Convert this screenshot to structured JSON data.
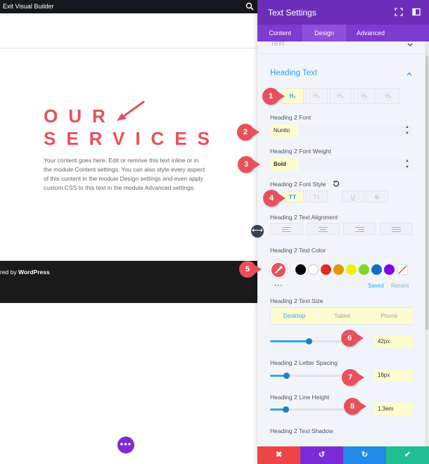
{
  "canvas": {
    "topbar": {
      "exit_label": "Exit Visual Builder"
    },
    "hero": {
      "heading_line1": "OUR",
      "heading_line2": "SERVICES",
      "heading_color": "#e8505b",
      "body": "Your content goes here. Edit or remove this text inline or in the module Content settings. You can also style every aspect of this content in the module Design settings and even apply custom CSS to this text in the module Advanced settings."
    },
    "footer": {
      "prefix": "red by ",
      "brand": "WordPress"
    },
    "dots_button": "•••"
  },
  "panel": {
    "title": "Text Settings",
    "tabs": [
      {
        "label": "Content",
        "active": false
      },
      {
        "label": "Design",
        "active": true
      },
      {
        "label": "Advanced",
        "active": false
      }
    ],
    "collapsed_section": "Text",
    "section_title": "Heading Text",
    "heading_levels": [
      {
        "label": "H₂",
        "active": true
      },
      {
        "label": "H₃",
        "active": false
      },
      {
        "label": "H₄",
        "active": false
      },
      {
        "label": "H₅",
        "active": false
      },
      {
        "label": "H₆",
        "active": false
      }
    ],
    "font": {
      "label": "Heading 2 Font",
      "value": "Nunito"
    },
    "weight": {
      "label": "Heading 2 Font Weight",
      "value": "Bold"
    },
    "style": {
      "label": "Heading 2 Font Style",
      "buttons": [
        {
          "label": "TT",
          "active": true
        },
        {
          "label": "Tт",
          "active": false
        },
        {
          "label": "U",
          "active": false
        },
        {
          "label": "S",
          "active": false
        }
      ]
    },
    "alignment": {
      "label": "Heading 2 Text Alignment"
    },
    "color": {
      "label": "Heading 2 Text Color",
      "current": "#e8505b",
      "swatches": [
        "#000000",
        "#ffffff",
        "#e02b20",
        "#e09900",
        "#edf000",
        "#7cda24",
        "#0c71c3",
        "#8300e9"
      ],
      "saved_label": "Saved",
      "recent_label": "Recent"
    },
    "size": {
      "label": "Heading 2 Text Size",
      "devices": [
        {
          "label": "Desktop",
          "active": true
        },
        {
          "label": "Tablet",
          "active": false
        },
        {
          "label": "Phone",
          "active": false
        }
      ],
      "value": "42px",
      "slider_fraction": 0.42
    },
    "letter_spacing": {
      "label": "Heading 2 Letter Spacing",
      "value": "16px",
      "slider_fraction": 0.18
    },
    "line_height": {
      "label": "Heading 2 Line Height",
      "value": "1.3em",
      "slider_fraction": 0.17
    },
    "shadow": {
      "label": "Heading 2 Text Shadow"
    },
    "footer_buttons": [
      {
        "name": "cancel",
        "symbol": "✖",
        "color": "#ef4444"
      },
      {
        "name": "undo",
        "symbol": "↺",
        "color": "#7b2bd4"
      },
      {
        "name": "redo",
        "symbol": "↻",
        "color": "#1f8ae8"
      },
      {
        "name": "save",
        "symbol": "✔",
        "color": "#1fbf8f"
      }
    ]
  },
  "markers": [
    "1",
    "2",
    "3",
    "4",
    "5",
    "6",
    "7",
    "8"
  ]
}
